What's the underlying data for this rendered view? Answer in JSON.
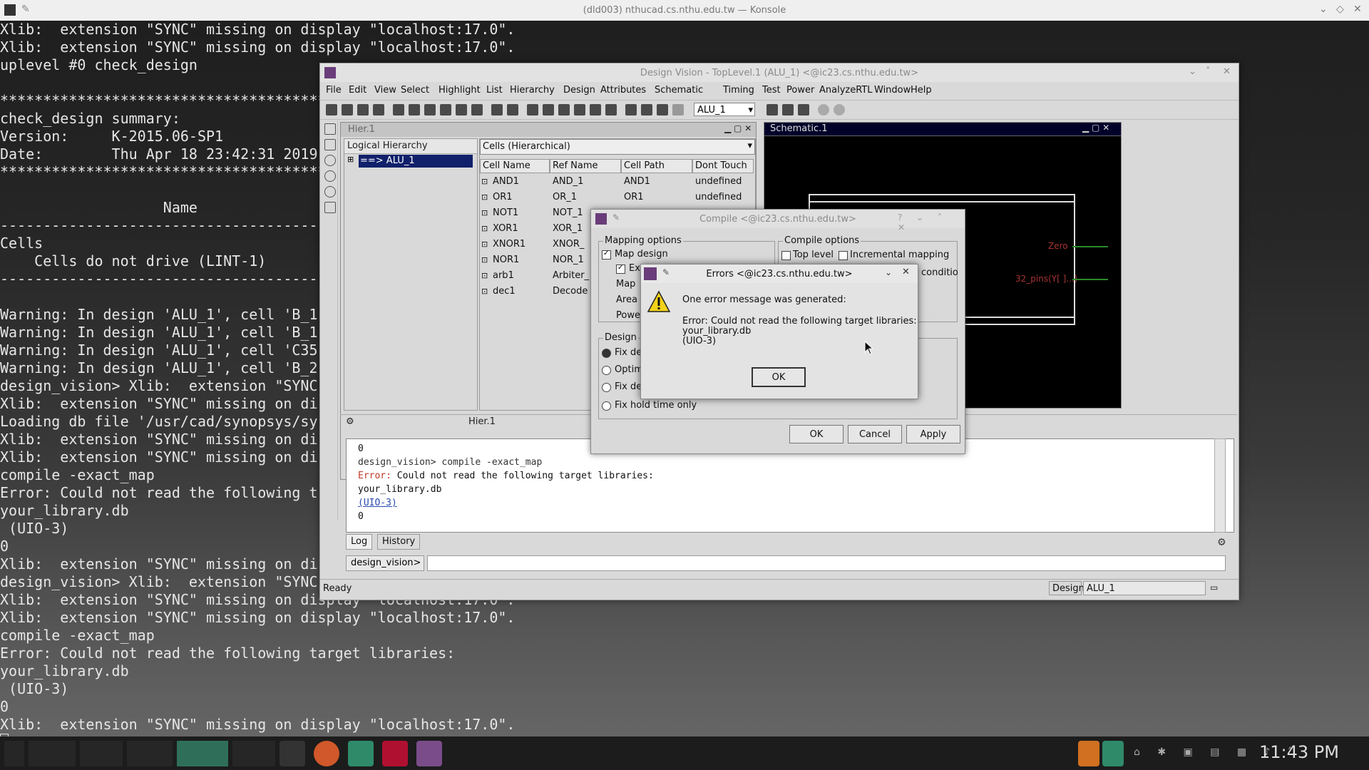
{
  "konsole": {
    "title": "(dld003) nthucad.cs.nthu.edu.tw — Konsole",
    "lines": [
      "Xlib:  extension \"SYNC\" missing on display \"localhost:17.0\".",
      "Xlib:  extension \"SYNC\" missing on display \"localhost:17.0\".",
      "uplevel #0 check_design",
      "",
      "****************************************************",
      "check_design summary:",
      "Version:     K-2015.06-SP1",
      "Date:        Thu Apr 18 23:42:31 2019",
      "****************************************************",
      "",
      "                   Name",
      "----------------------------------------------------",
      "Cells",
      "    Cells do not drive (LINT-1)",
      "----------------------------------------------------",
      "",
      "Warning: In design 'ALU_1', cell 'B_1",
      "Warning: In design 'ALU_1', cell 'B_1",
      "Warning: In design 'ALU_1', cell 'C35",
      "Warning: In design 'ALU_1', cell 'B_2",
      "design_vision> Xlib:  extension \"SYNC",
      "Xlib:  extension \"SYNC\" missing on di",
      "Loading db file '/usr/cad/synopsys/sy",
      "Xlib:  extension \"SYNC\" missing on di",
      "Xlib:  extension \"SYNC\" missing on di",
      "compile -exact_map",
      "Error: Could not read the following t",
      "your_library.db",
      " (UIO-3)",
      "0",
      "Xlib:  extension \"SYNC\" missing on di",
      "design_vision> Xlib:  extension \"SYNC",
      "Xlib:  extension \"SYNC\" missing on display \"localhost:17.0\".",
      "Xlib:  extension \"SYNC\" missing on display \"localhost:17.0\".",
      "compile -exact_map",
      "Error: Could not read the following target libraries:",
      "your_library.db",
      " (UIO-3)",
      "0",
      "Xlib:  extension \"SYNC\" missing on display \"localhost:17.0\"."
    ]
  },
  "taskbar": {
    "clock": "11:43 PM"
  },
  "dv": {
    "title": "Design Vision - TopLevel.1 (ALU_1) <@ic23.cs.nthu.edu.tw>",
    "menu": [
      "File",
      "Edit",
      "View",
      "Select",
      "Highlight",
      "List",
      "Hierarchy",
      "Design",
      "Attributes",
      "Schematic",
      "Timing",
      "Test",
      "Power",
      "AnalyzeRTL",
      "Window",
      "Help"
    ],
    "design_combo": "ALU_1",
    "hier_title": "Hier.1",
    "logical_hierarchy": "Logical Hierarchy",
    "tree_item": "==> ALU_1",
    "cells_combo": "Cells (Hierarchical)",
    "columns": [
      "Cell Name",
      "Ref Name",
      "Cell Path",
      "Dont Touch"
    ],
    "rows": [
      [
        "AND1",
        "AND_1",
        "AND1",
        "undefined"
      ],
      [
        "OR1",
        "OR_1",
        "OR1",
        "undefined"
      ],
      [
        "NOT1",
        "NOT_1",
        "",
        ""
      ],
      [
        "XOR1",
        "XOR_1",
        "",
        ""
      ],
      [
        "XNOR1",
        "XNOR_",
        "",
        ""
      ],
      [
        "NOR1",
        "NOR_1",
        "",
        ""
      ],
      [
        "arb1",
        "Arbiter_",
        "",
        ""
      ],
      [
        "dec1",
        "Decode",
        "",
        ""
      ]
    ],
    "schematic_title": "Schematic.1",
    "pin_zero": "Zero",
    "pin_32": "32_pins(Y[ ]...)",
    "hier1_bar": "Hier.1",
    "log_lines": [
      "0",
      "design_vision> compile -exact_map",
      "Error: Could not read the following target libraries:",
      "your_library.db",
      " (UIO-3)",
      "0"
    ],
    "log_error_word": "Error:",
    "tabs": [
      "Log",
      "History"
    ],
    "prompt": "design_vision>",
    "status": "Ready",
    "status_design_label": "Design",
    "status_design_value": "ALU_1"
  },
  "compile": {
    "title": "Compile <@ic23.cs.nthu.edu.tw>",
    "mapping_group": "Mapping options",
    "map_design": "Map design",
    "ex": "Ex",
    "map": "Map",
    "area": "Area",
    "power": "Powe",
    "compile_group": "Compile options",
    "top_level": "Top level",
    "incremental": "Incremental mapping",
    "conditio": "conditio",
    "design_group": "Design",
    "fix_de": "Fix de",
    "optim": "Optim",
    "fix_de2": "Fix de",
    "fix_hold": "Fix hold time only",
    "ok": "OK",
    "cancel": "Cancel",
    "apply": "Apply"
  },
  "errors": {
    "title": "Errors <@ic23.cs.nthu.edu.tw>",
    "heading": "One error message was generated:",
    "line1": "Error: Could not read the following target libraries:",
    "line2": "your_library.db",
    "line3": " (UIO-3)",
    "ok": "OK"
  }
}
